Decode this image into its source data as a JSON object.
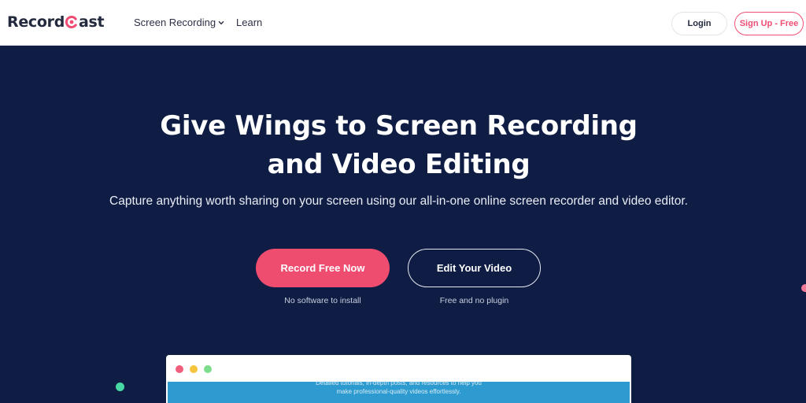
{
  "brand": {
    "name_part1": "Record",
    "name_part2": "ast",
    "accent": "#ef4d74"
  },
  "nav": {
    "items": [
      {
        "label": "Screen Recording",
        "icon": "chevron-down-icon"
      },
      {
        "label": "Learn"
      }
    ],
    "login_label": "Login",
    "signup_label": "Sign Up - Free"
  },
  "hero": {
    "title_line1": "Give Wings to Screen Recording",
    "title_line2": "and Video Editing",
    "subtitle": "Capture anything worth sharing on your screen using our all-in-one online screen recorder and video editor.",
    "primary_button": "Record Free Now",
    "secondary_button": "Edit Your Video",
    "primary_note": "No software to install",
    "secondary_note": "Free and no plugin",
    "background": "#0f1d45"
  },
  "preview": {
    "text_line1": "Detailed tutorials, in-depth posts, and resources to help you",
    "text_line2": "make professional-quality videos effortlessly."
  }
}
